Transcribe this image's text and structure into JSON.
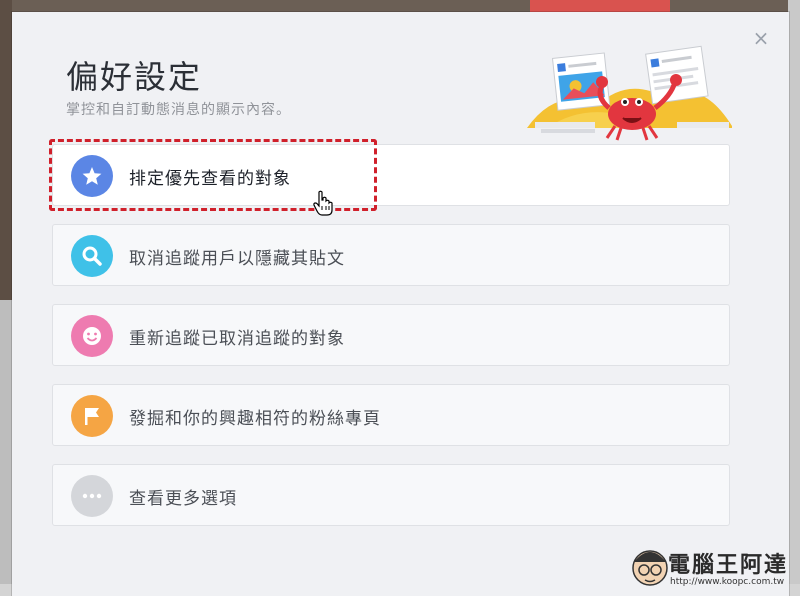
{
  "dialog": {
    "title": "偏好設定",
    "subtitle": "掌控和自訂動態消息的顯示內容。",
    "close_icon": "×"
  },
  "options": [
    {
      "label": "排定優先查看的對象",
      "icon": "star-icon",
      "color": "#5b86e5"
    },
    {
      "label": "取消追蹤用戶以隱藏其貼文",
      "icon": "search-icon",
      "color": "#3fc1e8"
    },
    {
      "label": "重新追蹤已取消追蹤的對象",
      "icon": "smile-icon",
      "color": "#ee7bb0"
    },
    {
      "label": "發掘和你的興趣相符的粉絲專頁",
      "icon": "flag-icon",
      "color": "#f5a544"
    },
    {
      "label": "查看更多選項",
      "icon": "more-icon",
      "color": "#d4d6da"
    }
  ],
  "watermark": {
    "title": "電腦王阿達",
    "url": "http://www.koopc.com.tw"
  }
}
